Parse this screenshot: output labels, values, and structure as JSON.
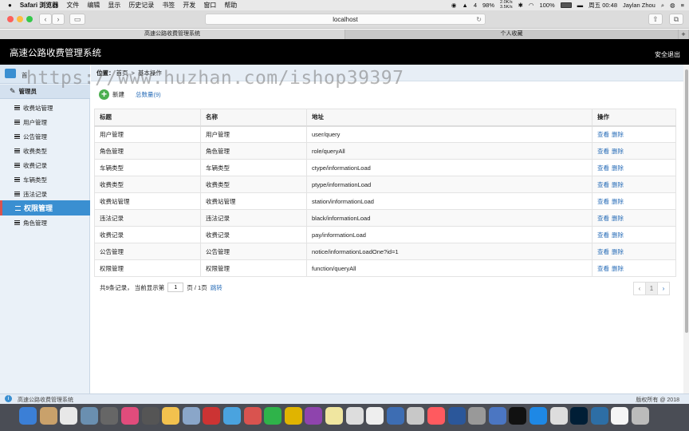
{
  "menubar": {
    "app": "Safari 浏览器",
    "items": [
      "文件",
      "编辑",
      "显示",
      "历史记录",
      "书签",
      "开发",
      "窗口",
      "帮助"
    ],
    "battery": "98%",
    "net_up": "2.0K/s",
    "net_down": "3.5K/s",
    "battery2": "100%",
    "clock": "周五 00:48",
    "user": "Jaylan Zhou",
    "badge": "4"
  },
  "browser": {
    "url": "localhost",
    "tabs": [
      "高速公路收费管理系统",
      "个人收藏"
    ]
  },
  "app": {
    "title": "高速公路收费管理系统",
    "logout": "安全退出",
    "home_label": "首"
  },
  "sidebar": {
    "group": "管理员",
    "items": [
      "收费站管理",
      "用户管理",
      "公告管理",
      "收费类型",
      "收费记录",
      "车辆类型",
      "违法记录"
    ],
    "active": "权限管理",
    "sub_items": [
      "角色管理"
    ]
  },
  "breadcrumb": {
    "label": "位置：",
    "home": "首页",
    "sep": ">",
    "current": "基本操作"
  },
  "actions": {
    "new_label": "新建",
    "total": "总数量(9)"
  },
  "table": {
    "headers": [
      "标题",
      "名称",
      "地址",
      "操作"
    ],
    "rows": [
      [
        "用户管理",
        "用户管理",
        "user/query"
      ],
      [
        "角色管理",
        "角色管理",
        "role/queryAll"
      ],
      [
        "车辆类型",
        "车辆类型",
        "ctype/informationLoad"
      ],
      [
        "收费类型",
        "收费类型",
        "ptype/informationLoad"
      ],
      [
        "收费站管理",
        "收费站管理",
        "station/informationLoad"
      ],
      [
        "违法记录",
        "违法记录",
        "black/informationLoad"
      ],
      [
        "收费记录",
        "收费记录",
        "pay/informationLoad"
      ],
      [
        "公告管理",
        "公告管理",
        "notice/informationLoadOne?id=1"
      ],
      [
        "权限管理",
        "权限管理",
        "function/queryAll"
      ]
    ],
    "view_label": "查看",
    "delete_label": "删除"
  },
  "pager": {
    "summary": "共9条记录，  当前显示第",
    "page_value": "1",
    "page_suffix": "页 / 1页",
    "jump": "跳转",
    "prev": "‹",
    "current": "1",
    "next": "›"
  },
  "status": {
    "left": "高速公路收费管理系统",
    "right": "版权所有 @ 2018"
  },
  "watermark": "https://www.huzhan.com/ishop39397",
  "colors": {
    "accent": "#3a8fd1",
    "link": "#2a6eb8",
    "header_bg": "#000000"
  }
}
